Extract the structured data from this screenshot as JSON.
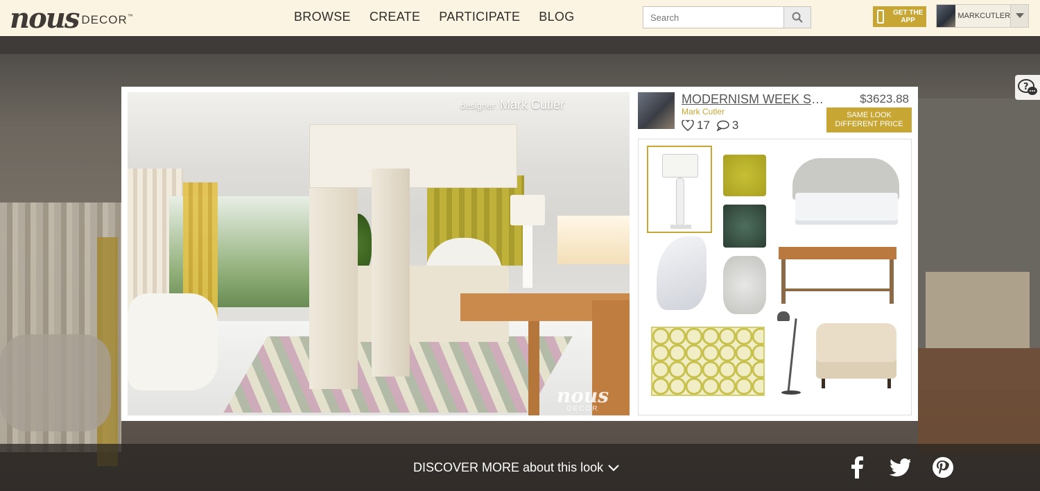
{
  "header": {
    "logo_script": "nous",
    "logo_word": "DECOR",
    "logo_tm": "™",
    "nav": [
      "BROWSE",
      "CREATE",
      "PARTICIPATE",
      "BLOG"
    ],
    "search_placeholder": "Search",
    "get_app_label": "GET THE APP",
    "username": "MARKCUTLER"
  },
  "look": {
    "photo_caption_prefix": "designer:",
    "photo_caption_name": "Mark Cutler",
    "watermark_script": "nous",
    "watermark_word": "DECOR",
    "title": "MODERNISM WEEK SH...",
    "designer": "Mark Cutler",
    "price": "$3623.88",
    "likes": "17",
    "comments": "3",
    "same_look_label_1": "SAME LOOK",
    "same_look_label_2": "DIFFERENT PRICE"
  },
  "board": {
    "items": [
      "table-lamp",
      "yellow-pillow",
      "upholstered-bed",
      "green-pillow",
      "white-panton-chair",
      "ceramic-garden-stool",
      "wood-desk",
      "yellow-trellis-rug",
      "floor-lamp",
      "armchair"
    ]
  },
  "footer": {
    "discover_label": "DISCOVER MORE about this look",
    "social": [
      "facebook-icon",
      "twitter-icon",
      "pinterest-icon"
    ]
  },
  "colors": {
    "header_bg": "#fbf4e2",
    "accent_gold": "#c8a633",
    "footer_bg": "#2a2623"
  }
}
